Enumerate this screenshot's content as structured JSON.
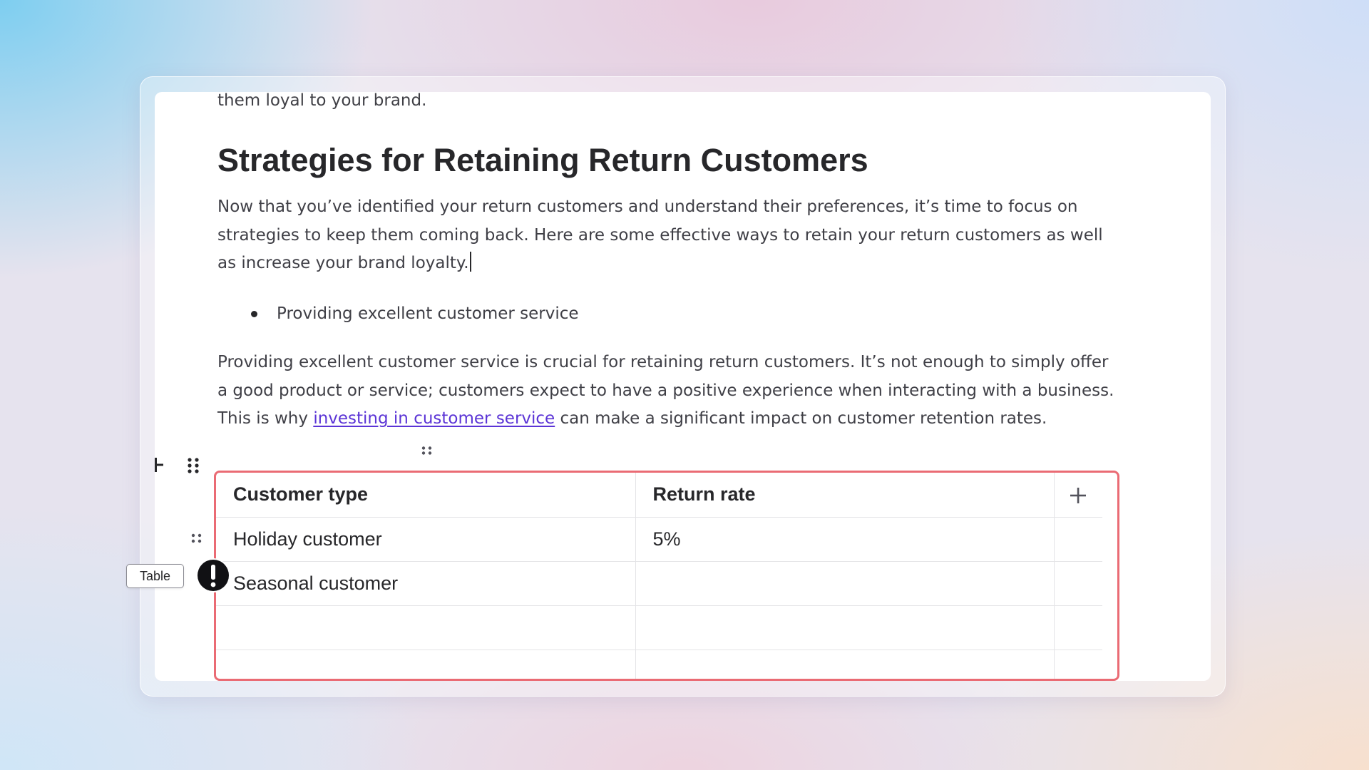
{
  "document": {
    "lead_text": "them loyal to your brand.",
    "heading": "Strategies for Retaining Return Customers",
    "intro_paragraph": "Now that you’ve identified your return customers and understand their preferences, it’s time to focus on strategies to keep them coming back. Here are some effective ways to retain your return customers as well as increase your brand loyalty.",
    "bullets": [
      "Providing excellent customer service"
    ],
    "body_paragraph": {
      "before_link": "Providing excellent customer service is crucial for retaining return customers. It’s not enough to simply offer a good product or service; customers expect to have a positive experience when interacting with a business. This is why ",
      "link_text": "investing in customer service",
      "after_link": " can make a significant impact on customer retention rates."
    }
  },
  "table": {
    "headers": [
      "Customer type",
      "Return rate"
    ],
    "rows": [
      [
        "Holiday customer",
        "5%"
      ],
      [
        "Seasonal customer",
        ""
      ],
      [
        "",
        ""
      ],
      [
        "",
        ""
      ]
    ],
    "selection_color": "#ea6b74"
  },
  "block_tooltip": {
    "label": "Table"
  },
  "icons": {
    "add_block": "add-block-icon",
    "block_drag": "drag-handle-icon",
    "column_drag": "column-drag-icon",
    "row_drag": "row-drag-icon",
    "add_column": "plus-icon",
    "warning": "warning-icon"
  }
}
